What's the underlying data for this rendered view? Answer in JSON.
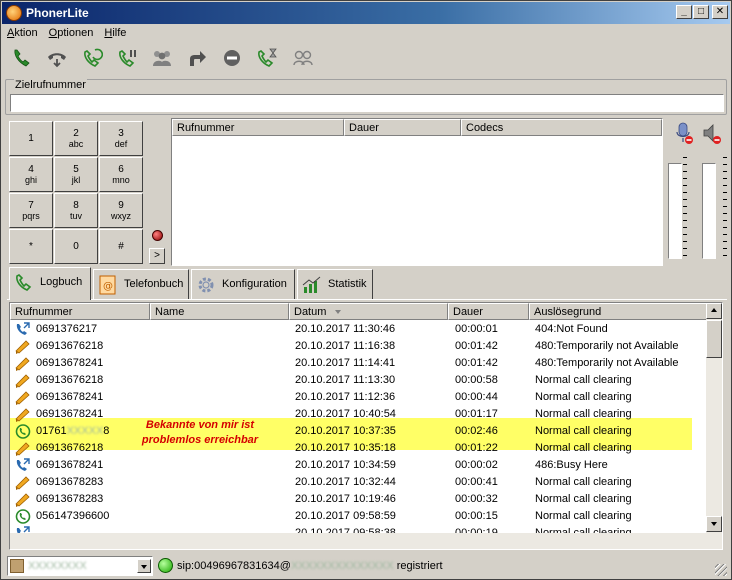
{
  "window": {
    "title": "PhonerLite"
  },
  "menu": [
    {
      "label": "Aktion",
      "accel": "A",
      "rest": "ktion"
    },
    {
      "label": "Optionen",
      "accel": "O",
      "rest": "ptionen"
    },
    {
      "label": "Hilfe",
      "accel": "H",
      "rest": "ilfe"
    }
  ],
  "destination": {
    "label": "Zielrufnummer",
    "value": ""
  },
  "keypad": [
    {
      "digit": "1",
      "letters": ""
    },
    {
      "digit": "2",
      "letters": "abc"
    },
    {
      "digit": "3",
      "letters": "def"
    },
    {
      "digit": "4",
      "letters": "ghi"
    },
    {
      "digit": "5",
      "letters": "jkl"
    },
    {
      "digit": "6",
      "letters": "mno"
    },
    {
      "digit": "7",
      "letters": "pqrs"
    },
    {
      "digit": "8",
      "letters": "tuv"
    },
    {
      "digit": "9",
      "letters": "wxyz"
    },
    {
      "digit": "*",
      "letters": ""
    },
    {
      "digit": "0",
      "letters": ""
    },
    {
      "digit": "#",
      "letters": ""
    }
  ],
  "keypad_arrow": ">",
  "calls_columns": [
    "Rufnummer",
    "Dauer",
    "Codecs"
  ],
  "tabs": [
    {
      "label": "Logbuch",
      "icon": "phone-log-icon"
    },
    {
      "label": "Telefonbuch",
      "icon": "phonebook-icon"
    },
    {
      "label": "Konfiguration",
      "icon": "gear-icon"
    },
    {
      "label": "Statistik",
      "icon": "chart-icon"
    }
  ],
  "log": {
    "columns": [
      "Rufnummer",
      "Name",
      "Datum",
      "Dauer",
      "Auslösegrund"
    ],
    "rows": [
      {
        "icon": "outgoing-call-icon",
        "number": "0691376217",
        "name": "",
        "date": "20.10.2017 11:30:46",
        "duration": "00:00:01",
        "reason": "404:Not Found"
      },
      {
        "icon": "missed-call-icon",
        "number": "06913676218",
        "name": "",
        "date": "20.10.2017 11:16:38",
        "duration": "00:01:42",
        "reason": "480:Temporarily not Available"
      },
      {
        "icon": "missed-call-icon",
        "number": "06913678241",
        "name": "",
        "date": "20.10.2017 11:14:41",
        "duration": "00:01:42",
        "reason": "480:Temporarily not Available"
      },
      {
        "icon": "missed-call-icon",
        "number": "06913676218",
        "name": "",
        "date": "20.10.2017 11:13:30",
        "duration": "00:00:58",
        "reason": "Normal call clearing"
      },
      {
        "icon": "missed-call-icon",
        "number": "06913678241",
        "name": "",
        "date": "20.10.2017 11:12:36",
        "duration": "00:00:44",
        "reason": "Normal call clearing"
      },
      {
        "icon": "missed-call-icon",
        "number": "06913678241",
        "name": "",
        "date": "20.10.2017 10:40:54",
        "duration": "00:01:17",
        "reason": "Normal call clearing"
      },
      {
        "icon": "incoming-call-icon",
        "number": "01761",
        "number_blur": "XXXXX",
        "number_tail": "8",
        "name": "",
        "date": "20.10.2017 10:37:35",
        "duration": "00:02:46",
        "reason": "Normal call clearing",
        "highlight": true
      },
      {
        "icon": "missed-call-icon",
        "number": "06913676218",
        "name": "",
        "date": "20.10.2017 10:35:18",
        "duration": "00:01:22",
        "reason": "Normal call clearing"
      },
      {
        "icon": "outgoing-call-icon",
        "number": "06913678241",
        "name": "",
        "date": "20.10.2017 10:34:59",
        "duration": "00:00:02",
        "reason": "486:Busy Here"
      },
      {
        "icon": "missed-call-icon",
        "number": "06913678283",
        "name": "",
        "date": "20.10.2017 10:32:44",
        "duration": "00:00:41",
        "reason": "Normal call clearing"
      },
      {
        "icon": "missed-call-icon",
        "number": "06913678283",
        "name": "",
        "date": "20.10.2017 10:19:46",
        "duration": "00:00:32",
        "reason": "Normal call clearing"
      },
      {
        "icon": "incoming-call-icon",
        "number": "056147396600",
        "name": "",
        "date": "20.10.2017 09:58:59",
        "duration": "00:00:15",
        "reason": "Normal call clearing"
      },
      {
        "icon": "outgoing-call-icon",
        "number": "",
        "name": "",
        "date": "20.10.2017 09:58:38",
        "duration": "00:00:19",
        "reason": "Normal call clearing"
      }
    ]
  },
  "annotation": {
    "line1": "Bekannte von mir ist",
    "line2": "problemlos erreichbar"
  },
  "status": {
    "account": "XXXXXXXX",
    "sip_prefix": "sip:00496967831634@",
    "sip_blur": "XXXXXXXXXXXXXX",
    "state": "registriert"
  },
  "colors": {
    "highlight": "#ffff66",
    "annotation": "#d40000",
    "call_green": "#2a8a2a"
  }
}
